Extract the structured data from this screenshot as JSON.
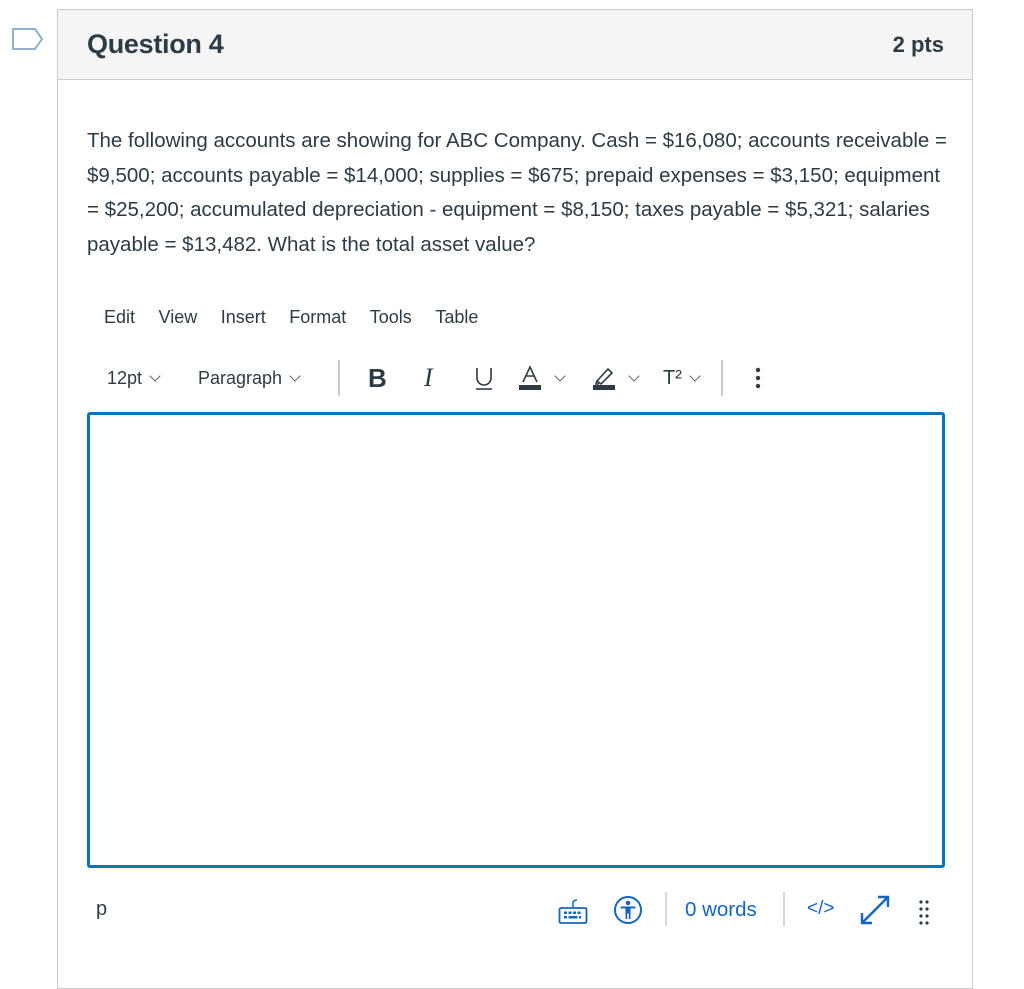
{
  "question": {
    "title": "Question 4",
    "points": "2 pts",
    "text": "The following accounts are showing for ABC Company. Cash = $16,080; accounts receivable = $9,500; accounts payable = $14,000; supplies = $675; prepaid expenses = $3,150; equipment = $25,200; accumulated depreciation - equipment = $8,150; taxes payable = $5,321; salaries payable = $13,482. What is the total asset value?",
    "flag_icon": "bookmark-flag-icon"
  },
  "editor": {
    "menu": [
      "Edit",
      "View",
      "Insert",
      "Format",
      "Tools",
      "Table"
    ],
    "toolbar": {
      "font_size": "12pt",
      "block_format": "Paragraph",
      "bold_label": "B",
      "italic_label": "I",
      "underline_label": "U",
      "text_color_label": "A",
      "superscript_label": "T²",
      "more_icon": "more-vertical-icon"
    },
    "content": "",
    "status": {
      "path": "p",
      "word_count": "0 words",
      "html_toggle": "</>",
      "colors": {
        "accent": "#0b74b8",
        "link": "#1565c0",
        "text": "#2d3b45",
        "border": "#c7cdd1"
      }
    }
  }
}
